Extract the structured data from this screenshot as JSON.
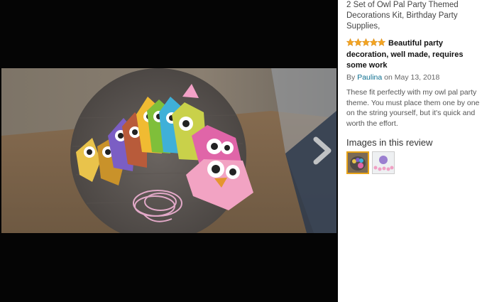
{
  "product": {
    "title": "2 Set of Owl Pal Party Themed Decorations Kit, Birthday Party Supplies,"
  },
  "review": {
    "rating": 5,
    "headline": "Beautiful party decoration, well made, requires some work",
    "by_prefix": "By",
    "author": "Paulina",
    "date_text": "on May 13, 2018",
    "body": "These fit perfectly with my owl pal party theme. You must place them one by one on the string yourself, but it's quick and worth the effort."
  },
  "images_section": {
    "heading": "Images in this review",
    "thumbnail_count": 2,
    "selected_index": 0
  },
  "colors": {
    "star": "#f5a623",
    "link": "#0b6e8f",
    "selected_thumb_border": "#e8a317"
  }
}
